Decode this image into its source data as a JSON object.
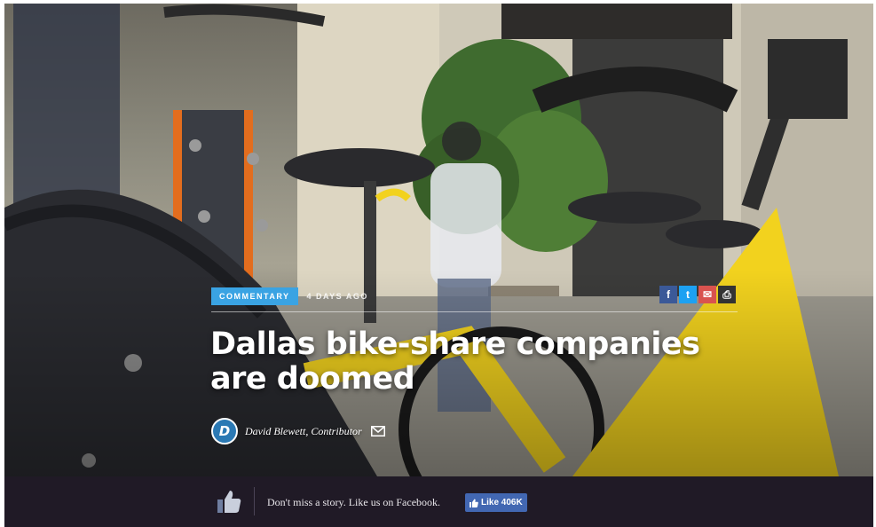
{
  "article": {
    "category": "COMMENTARY",
    "age": "4 DAYS AGO",
    "headline": "Dallas bike-share companies are doomed",
    "author": "David Blewett, Contributor",
    "logo_letter": "D",
    "share": [
      {
        "icon": "facebook-icon",
        "glyph": "f",
        "color": "#3b5998"
      },
      {
        "icon": "twitter-icon",
        "glyph": "t",
        "color": "#1da1f2"
      },
      {
        "icon": "email-icon",
        "glyph": "✉",
        "color": "#d9534f"
      },
      {
        "icon": "print-icon",
        "glyph": "⎙",
        "color": "#333333"
      }
    ]
  },
  "footer": {
    "promo": "Don't miss a story. Like us on Facebook.",
    "like_label": "Like 406K"
  },
  "colors": {
    "tag": "#3aa3e3",
    "footer_bg": "#201a26",
    "like_button": "#4267b2",
    "bike_yellow": "#f2d21e"
  }
}
